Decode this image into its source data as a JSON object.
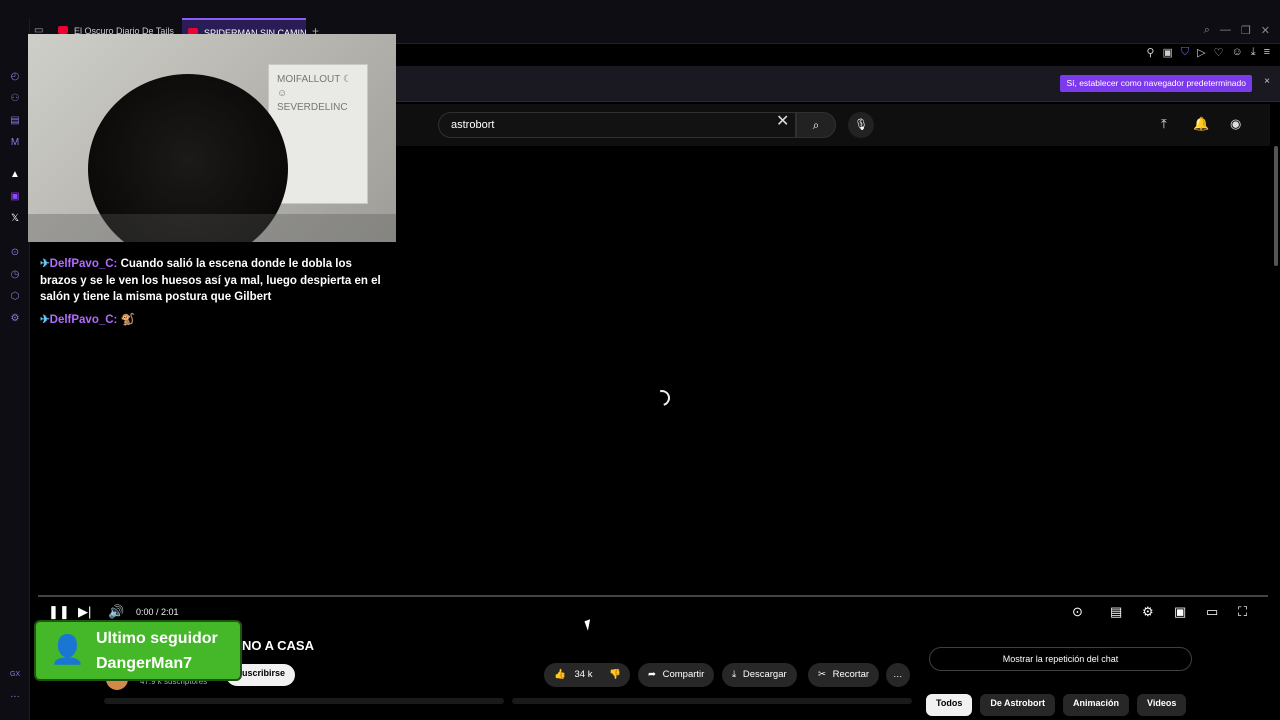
{
  "browser": {
    "tabs": [
      {
        "label": "El Oscuro Diario De Tails"
      },
      {
        "label": "SPIDERMAN SIN CAMINO"
      }
    ],
    "new_tab": "+"
  },
  "notification": {
    "button_label": "Sí, establecer como navegador predeterminado",
    "close": "×"
  },
  "search": {
    "value": "astrobort"
  },
  "stream_chat": [
    {
      "user": "DelfPavo_C:",
      "message": " Cuando salió la escena donde le dobla los brazos y se le ven los huesos así ya mal, luego despierta en el salón y tiene la misma postura que Gilbert"
    },
    {
      "user": "DelfPavo_C:",
      "message": " 🐒"
    }
  ],
  "webcam": {
    "poster_text": "MOIFALLOUT ☾ ☺ SEVERDELINC"
  },
  "player": {
    "time": "0:00 / 2:01"
  },
  "follower_alert": {
    "line1": "Ultimo seguidor",
    "line2": "DangerMan7"
  },
  "video": {
    "title_fragment": "NO A CASA",
    "subscribers": "47.9 k suscriptores",
    "subscribe_label": "Suscribirse",
    "likes": "34 k",
    "share_label": "Compartir",
    "download_label": "Descargar",
    "clip_label": "Recortar",
    "more_label": "…"
  },
  "side_panel": {
    "chat_replay_label": "Mostrar la repetición del chat",
    "chips": [
      "Todos",
      "De Astrobort",
      "Animación",
      "Videos"
    ]
  },
  "colors": {
    "accent": "#7c3aed",
    "follow_card": "#45b829",
    "chat_user": "#b36bff"
  }
}
